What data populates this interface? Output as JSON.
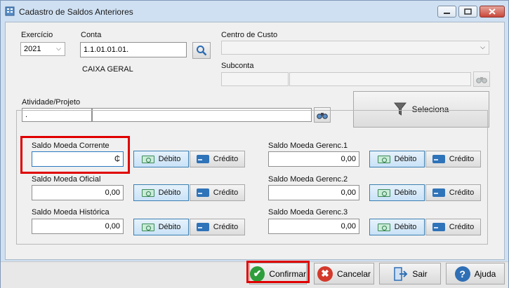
{
  "window": {
    "title": "Cadastro de Saldos Anteriores"
  },
  "fields": {
    "exercicio": {
      "label": "Exercício",
      "value": "2021"
    },
    "conta": {
      "label": "Conta",
      "value": "1.1.01.01.01.",
      "description": "CAIXA GERAL"
    },
    "centro_custo": {
      "label": "Centro de Custo",
      "value": ""
    },
    "subconta": {
      "label": "Subconta",
      "code": "",
      "name": ""
    },
    "atividade": {
      "label": "Atividade/Projeto",
      "code": ".",
      "name": ""
    }
  },
  "seleciona_button": {
    "label": "Seleciona",
    "icon": "filter-icon"
  },
  "saldos_left": [
    {
      "label": "Saldo Moeda Corrente",
      "value": "₵",
      "debit_label": "Débito",
      "credit_label": "Crédito"
    },
    {
      "label": "Saldo Moeda Oficial",
      "value": "0,00",
      "debit_label": "Débito",
      "credit_label": "Crédito"
    },
    {
      "label": "Saldo Moeda Histórica",
      "value": "0,00",
      "debit_label": "Débito",
      "credit_label": "Crédito"
    }
  ],
  "saldos_right": [
    {
      "label": "Saldo Moeda Gerenc.1",
      "value": "0,00",
      "debit_label": "Débito",
      "credit_label": "Crédito"
    },
    {
      "label": "Saldo Moeda Gerenc.2",
      "value": "0,00",
      "debit_label": "Débito",
      "credit_label": "Crédito"
    },
    {
      "label": "Saldo Moeda Gerenc.3",
      "value": "0,00",
      "debit_label": "Débito",
      "credit_label": "Crédito"
    }
  ],
  "footer": {
    "confirmar": "Confirmar",
    "cancelar": "Cancelar",
    "sair": "Sair",
    "ajuda": "Ajuda"
  },
  "colors": {
    "highlight": "#e00000",
    "accent": "#3c7fb1",
    "confirm": "#2e9e3c",
    "cancel": "#d33a2c",
    "help": "#2f6fb5"
  }
}
